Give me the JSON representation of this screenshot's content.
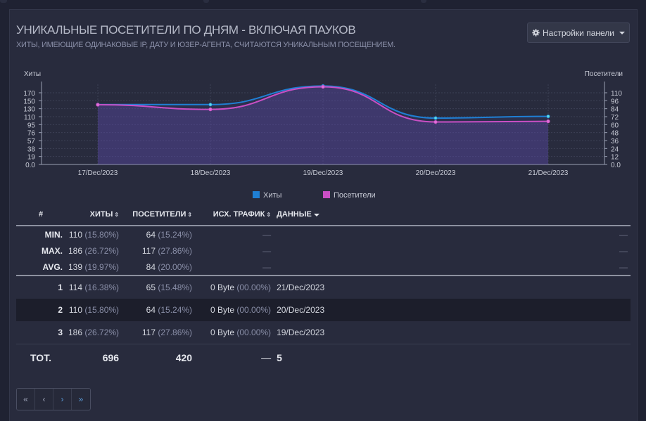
{
  "panel": {
    "title": "УНИКАЛЬНЫЕ ПОСЕТИТЕЛИ ПО ДНЯМ - ВКЛЮЧАЯ ПАУКОВ",
    "subtitle": "ХИТЫ, ИМЕЮЩИЕ ОДИНАКОВЫЕ IP, ДАТУ И ЮЗЕР-АГЕНТА, СЧИТАЮТСЯ УНИКАЛЬНЫМ ПОСЕЩЕНИЕМ.",
    "settings_label": "Настройки панели",
    "settings_icon": "gear-icon"
  },
  "chart_data": {
    "type": "line",
    "categories": [
      "17/Dec/2023",
      "18/Dec/2023",
      "19/Dec/2023",
      "20/Dec/2023",
      "21/Dec/2023"
    ],
    "series": [
      {
        "name": "Хиты",
        "axis": "left",
        "color": "#1f7fd4",
        "values": [
          142,
          142,
          186,
          110,
          114
        ]
      },
      {
        "name": "Посетители",
        "axis": "right",
        "color": "#c94fc4",
        "values": [
          90,
          83,
          117,
          64,
          65
        ]
      }
    ],
    "y_left": {
      "label": "Хиты",
      "min": 0,
      "max": 190,
      "ticks": [
        "0.0",
        "19",
        "38",
        "57",
        "76",
        "95",
        "110",
        "130",
        "150",
        "170"
      ]
    },
    "y_right": {
      "label": "Посетители",
      "min": 0,
      "max": 120,
      "ticks": [
        "0.0",
        "12",
        "24",
        "36",
        "48",
        "60",
        "72",
        "84",
        "96",
        "110"
      ]
    },
    "grid": true,
    "legend_position": "bottom-center"
  },
  "table": {
    "headers": {
      "num": "#",
      "hits": "ХИТЫ",
      "visitors": "ПОСЕТИТЕЛИ",
      "traffic": "ИСХ. ТРАФИК",
      "data": "ДАННЫЕ"
    },
    "summary": [
      {
        "label": "MIN.",
        "hits": "110",
        "hits_pct": "(15.80%)",
        "visitors": "64",
        "visitors_pct": "(15.24%)",
        "traffic": "—",
        "data": "—"
      },
      {
        "label": "MAX.",
        "hits": "186",
        "hits_pct": "(26.72%)",
        "visitors": "117",
        "visitors_pct": "(27.86%)",
        "traffic": "—",
        "data": "—"
      },
      {
        "label": "AVG.",
        "hits": "139",
        "hits_pct": "(19.97%)",
        "visitors": "84",
        "visitors_pct": "(20.00%)",
        "traffic": "—",
        "data": "—"
      }
    ],
    "rows": [
      {
        "num": "1",
        "hits": "114",
        "hits_pct": "(16.38%)",
        "visitors": "65",
        "visitors_pct": "(15.48%)",
        "traffic": "0 Byte",
        "traffic_pct": "(00.00%)",
        "data": "21/Dec/2023"
      },
      {
        "num": "2",
        "hits": "110",
        "hits_pct": "(15.80%)",
        "visitors": "64",
        "visitors_pct": "(15.24%)",
        "traffic": "0 Byte",
        "traffic_pct": "(00.00%)",
        "data": "20/Dec/2023"
      },
      {
        "num": "3",
        "hits": "186",
        "hits_pct": "(26.72%)",
        "visitors": "117",
        "visitors_pct": "(27.86%)",
        "traffic": "0 Byte",
        "traffic_pct": "(00.00%)",
        "data": "19/Dec/2023"
      }
    ],
    "total": {
      "label": "TOT.",
      "hits": "696",
      "visitors": "420",
      "traffic": "—",
      "data": "5"
    }
  },
  "pager": {
    "first": "«",
    "prev": "‹",
    "next": "›",
    "last": "»"
  }
}
